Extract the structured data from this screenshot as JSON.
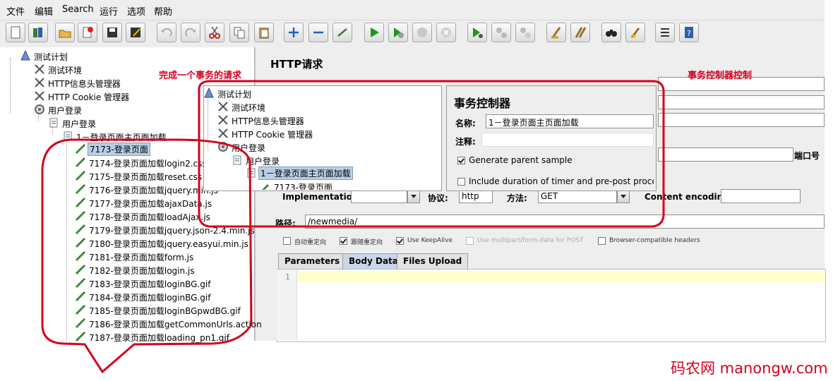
{
  "menu": [
    "文件",
    "编辑",
    "Search",
    "运行",
    "选项",
    "帮助"
  ],
  "tree": {
    "root": "测试计划",
    "config": [
      "测试环境",
      "HTTP信息头管理器",
      "HTTP Cookie 管理器"
    ],
    "thread_group": "用户登录",
    "controller_parent": "用户登录",
    "transaction": "1－登录页面主页面加载",
    "samplers": [
      "7173-登录页面",
      "7174-登录页面加载login2.css",
      "7175-登录页面加载reset.css",
      "7176-登录页面加载jquery.min.js",
      "7177-登录页面加载ajaxData.js",
      "7178-登录页面加载loadAjax.js",
      "7179-登录页面加载jquery.json-2.4.min.js",
      "7180-登录页面加载jquery.easyui.min.js",
      "7181-登录页面加载form.js",
      "7182-登录页面加载login.js",
      "7183-登录页面加载loginBG.gif",
      "7184-登录页面加载loginBG.gif",
      "7185-登录页面加载loginBGpwdBG.gif",
      "7186-登录页面加载getCommonUrls.action",
      "7187-登录页面加载loading_pn1.gif"
    ]
  },
  "http_panel": {
    "title": "HTTP请求",
    "port_label": "端口号",
    "implementation_label": "Implementation:",
    "protocol_label": "协议:",
    "protocol_value": "http",
    "method_label": "方法:",
    "method_value": "GET",
    "encoding_label": "Content encoding:",
    "path_label": "路径:",
    "path_value": "/newmedia/",
    "checkboxes": [
      {
        "label": "自动重定向",
        "checked": false
      },
      {
        "label": "跟随重定向",
        "checked": true
      },
      {
        "label": "Use KeepAlive",
        "checked": true
      },
      {
        "label": "Use multipart/form-data for POST",
        "checked": false
      },
      {
        "label": "Browser-compatible headers",
        "checked": false
      }
    ],
    "tabs": [
      "Parameters",
      "Body Data",
      "Files Upload"
    ],
    "active_tab": "Body Data",
    "line_number": "1"
  },
  "overlay": {
    "tree_root": "测试计划",
    "tree_config": [
      "测试环境",
      "HTTP信息头管理器",
      "HTTP Cookie 管理器"
    ],
    "tree_group": "用户登录",
    "tree_sub": "用户登录",
    "tree_transaction": "1－登录页面主页面加载",
    "tree_partial": "7173-登录页面",
    "panel_title": "事务控制器",
    "name_label": "名称:",
    "name_value": "1－登录页面主页面加载",
    "comment_label": "注释:",
    "generate_parent": "Generate parent sample",
    "include_duration": "Include duration of timer and pre-post process"
  },
  "annotations": {
    "left_note": "完成一个事务的请求",
    "right_note": "事务控制器控制"
  },
  "watermark": "码农网 manongw.com",
  "colors": {
    "annotation": "#d6001c",
    "selection": "#b8cfe5"
  }
}
